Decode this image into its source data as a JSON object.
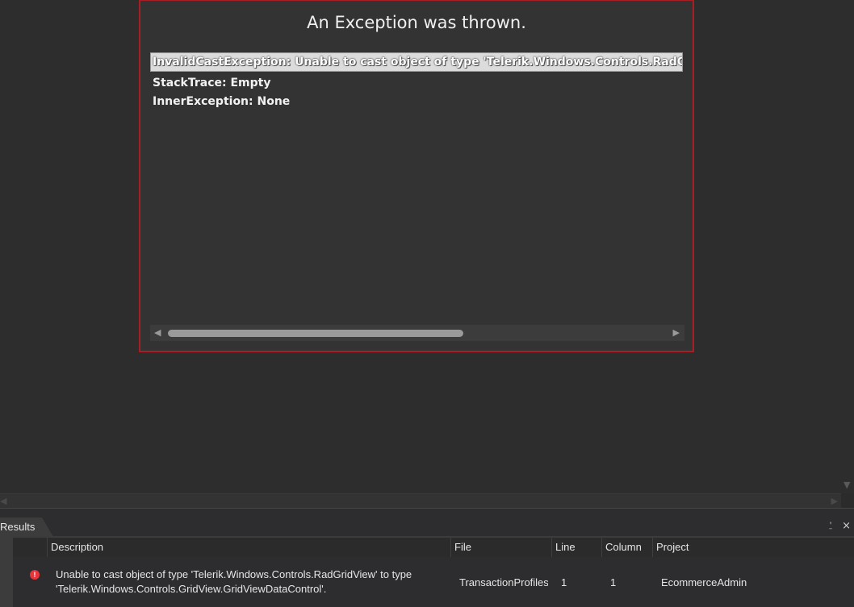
{
  "exception": {
    "title": "An Exception was thrown.",
    "message": "InvalidCastException: Unable to cast object of type 'Telerik.Windows.Controls.RadGridView' to",
    "stack_trace": "StackTrace: Empty",
    "inner_exception": "InnerException: None"
  },
  "results": {
    "tab_label": "Results",
    "pin_glyph": "⍘",
    "close_glyph": "×",
    "columns": [
      "Description",
      "File",
      "Line",
      "Column",
      "Project"
    ],
    "rows": [
      {
        "severity": "error",
        "icon_glyph": "!",
        "description": "Unable to cast object of type 'Telerik.Windows.Controls.RadGridView' to type 'Telerik.Windows.Controls.GridView.GridViewDataControl'.",
        "file": "TransactionProfiles",
        "line": "1",
        "column": "1",
        "project": "EcommerceAdmin"
      }
    ]
  },
  "colors": {
    "error_border": "#a81e22",
    "error_icon": "#e8343a"
  }
}
